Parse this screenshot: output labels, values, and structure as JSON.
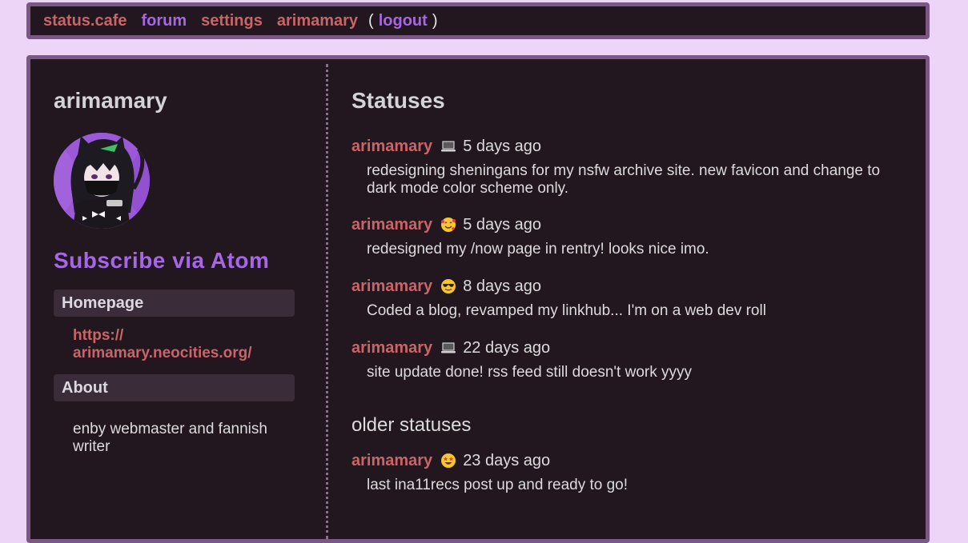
{
  "nav": {
    "site": "status.cafe",
    "forum": "forum",
    "settings": "settings",
    "user": "arimamary",
    "paren_open": "(",
    "logout": "logout",
    "paren_close": ")"
  },
  "profile": {
    "username": "arimamary",
    "subscribe": "Subscribe via Atom",
    "homepage_label": "Homepage",
    "homepage_url": "https:// arimamary.neocities.org/",
    "about_label": "About",
    "about_text": "enby webmaster and fannish writer"
  },
  "statuses": {
    "title": "Statuses",
    "items": [
      {
        "user": "arimamary",
        "face": "laptop-icon",
        "time": "5 days ago",
        "text": "redesigning sheningans for my nsfw archive site. new favicon and change to dark mode color scheme only."
      },
      {
        "user": "arimamary",
        "face": "smiling-face-with-hearts-icon",
        "time": "5 days ago",
        "text": "redesigned my /now page in rentry! looks nice imo."
      },
      {
        "user": "arimamary",
        "face": "sunglasses-face-icon",
        "time": "8 days ago",
        "text": "Coded a blog, revamped my linkhub... I'm on a web dev roll"
      },
      {
        "user": "arimamary",
        "face": "laptop-icon",
        "time": "22 days ago",
        "text": "site update done! rss feed still doesn't work yyyy"
      }
    ],
    "older_title": "older statuses",
    "older_items": [
      {
        "user": "arimamary",
        "face": "star-struck-face-icon",
        "time": "23 days ago",
        "text": "last ina11recs post up and ready to go!"
      }
    ]
  },
  "colors": {
    "background": "#edd5f7",
    "panel": "#22161f",
    "border": "#7a5784",
    "link_red": "#c96467",
    "link_purple": "#a666e6"
  }
}
